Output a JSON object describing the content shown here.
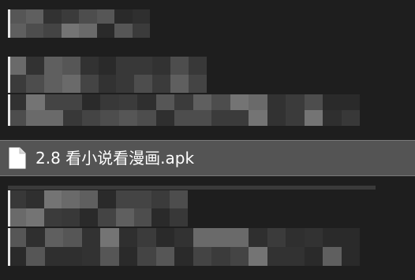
{
  "file_list": {
    "selected_item": {
      "icon": "file-icon",
      "name": "2.8 看小说看漫画.apk"
    }
  },
  "colors": {
    "background": "#1e1e1e",
    "selected_row": "#545454",
    "selected_border": "#7a7a7a",
    "text": "#ffffff"
  }
}
